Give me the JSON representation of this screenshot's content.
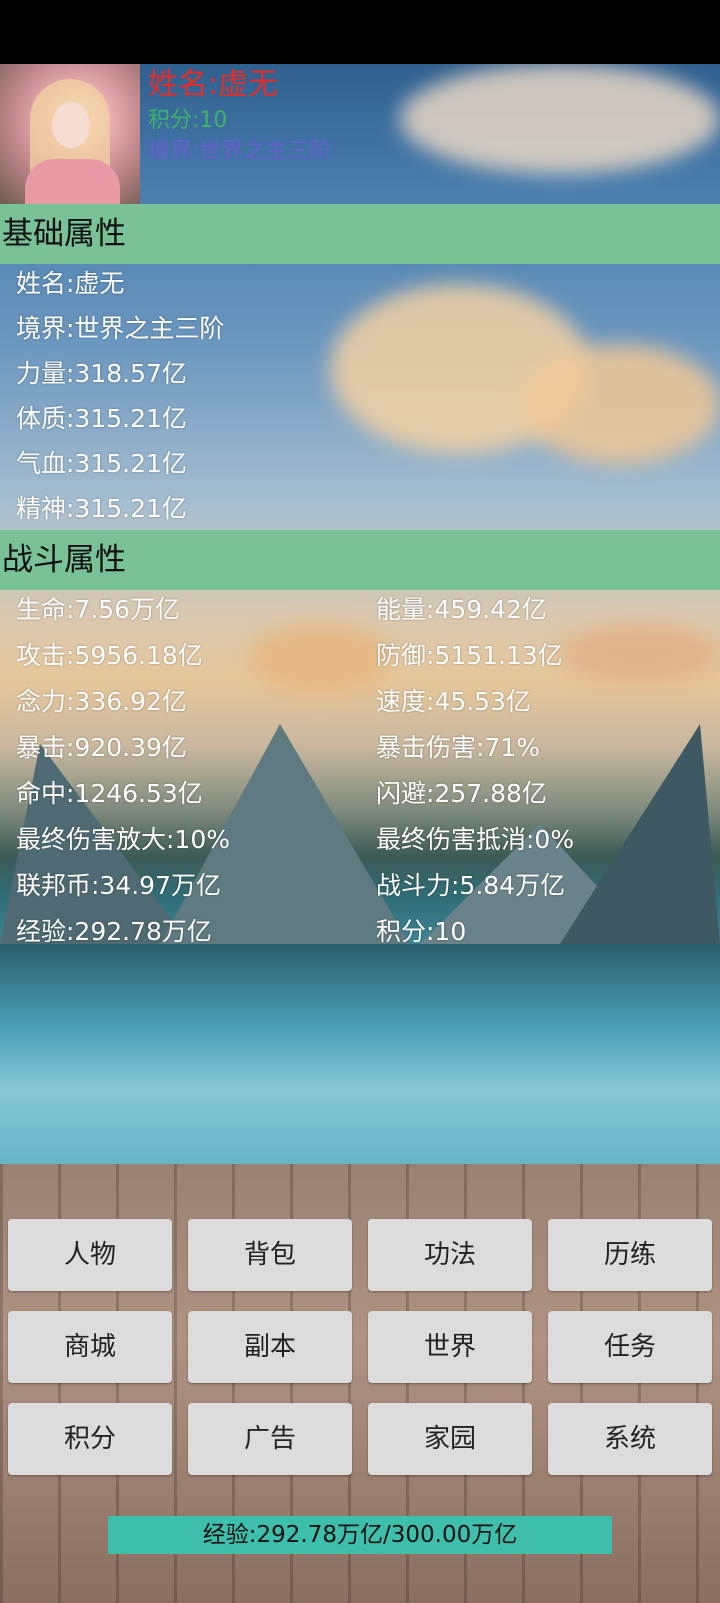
{
  "header": {
    "name": "姓名:虚无",
    "score": "积分:10",
    "realm": "境界:世界之主三阶"
  },
  "basic": {
    "title": "基础属性",
    "stats": [
      "姓名:虚无",
      "境界:世界之主三阶",
      "力量:318.57亿",
      "体质:315.21亿",
      "气血:315.21亿",
      "精神:315.21亿"
    ]
  },
  "combat": {
    "title": "战斗属性",
    "left": [
      "生命:7.56万亿",
      "攻击:5956.18亿",
      "念力:336.92亿",
      "暴击:920.39亿",
      "命中:1246.53亿",
      "最终伤害放大:10%",
      "联邦币:34.97万亿",
      "经验:292.78万亿"
    ],
    "right": [
      "能量:459.42亿",
      "防御:5151.13亿",
      "速度:45.53亿",
      "暴击伤害:71%",
      "闪避:257.88亿",
      "最终伤害抵消:0%",
      "战斗力:5.84万亿",
      "积分:10"
    ]
  },
  "menu": {
    "buttons": [
      "人物",
      "背包",
      "功法",
      "历练",
      "商城",
      "副本",
      "世界",
      "任务",
      "积分",
      "广告",
      "家园",
      "系统"
    ]
  },
  "exp": {
    "label": "经验:292.78万亿/300.00万亿",
    "progress": 0.976
  }
}
